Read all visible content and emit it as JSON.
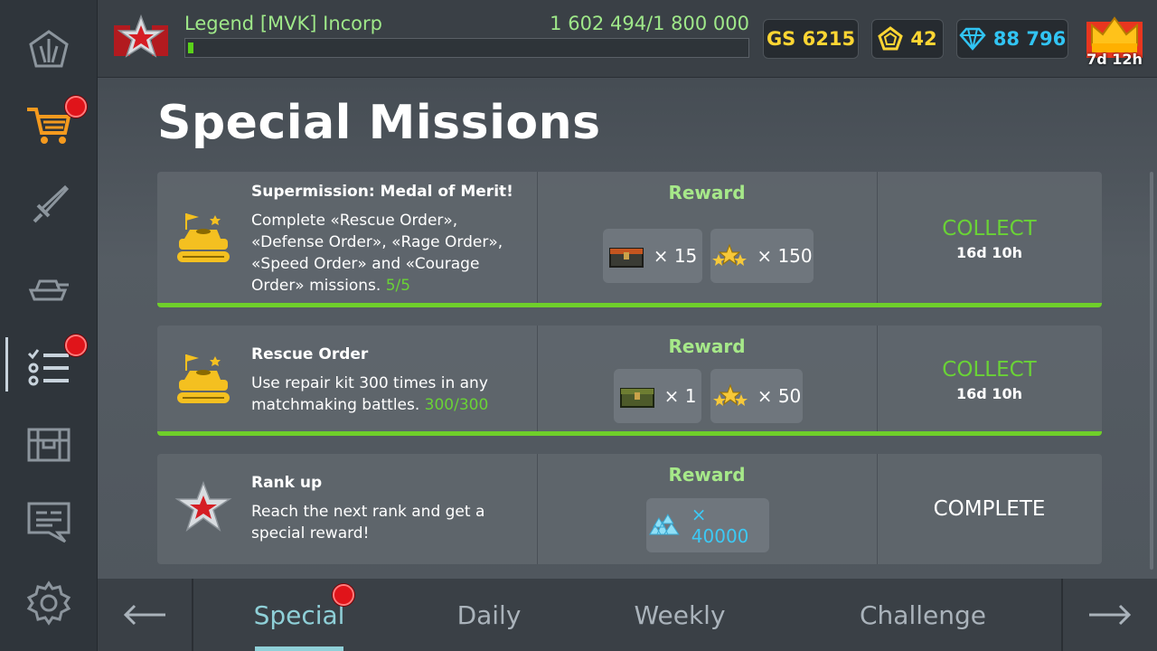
{
  "player": {
    "name": "Legend  [MVK] Incorp",
    "xp": "1 602 494/1 800 000",
    "xp_fraction": 0.01
  },
  "currencies": {
    "gs": "GS 6215",
    "coins": "42",
    "gems": "88 796",
    "crown_timer": "7d 12h"
  },
  "page": {
    "title": "Special Missions"
  },
  "missions": [
    {
      "title": "Supermission: Medal of Merit!",
      "desc": "Complete «Rescue Order», «Defense Order», «Rage Order», «Speed Order» and «Courage Order» missions.",
      "progress": "5/5",
      "reward_label": "Reward",
      "rewards": [
        {
          "icon": "chest-icon",
          "qty": "× 15"
        },
        {
          "icon": "stars-icon",
          "qty": "× 150"
        }
      ],
      "status": "COLLECT",
      "timer": "16d 10h"
    },
    {
      "title": "Rescue Order",
      "desc": "Use repair kit 300 times in any matchmaking battles.",
      "progress": "300/300",
      "reward_label": "Reward",
      "rewards": [
        {
          "icon": "green-chest-icon",
          "qty": "× 1"
        },
        {
          "icon": "stars-icon",
          "qty": "× 50"
        }
      ],
      "status": "COLLECT",
      "timer": "16d 10h"
    },
    {
      "title": "Rank up",
      "desc": "Reach the next rank and get a special reward!",
      "reward_label": "Reward",
      "rewards": [
        {
          "icon": "gems-pile-icon",
          "qty": "× 40000"
        }
      ],
      "status": "COMPLETE"
    }
  ],
  "tabs": [
    {
      "label": "Special",
      "active": true
    },
    {
      "label": "Daily"
    },
    {
      "label": "Weekly"
    },
    {
      "label": "Challenge"
    }
  ],
  "colors": {
    "accent_green": "#6ad336",
    "gold": "#ffd633",
    "gem_blue": "#31c4f3",
    "notif": "#e0141a"
  }
}
